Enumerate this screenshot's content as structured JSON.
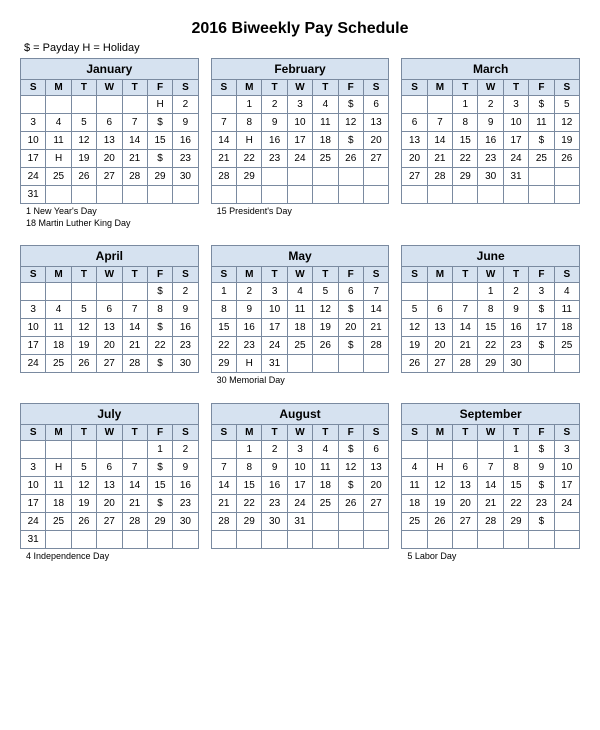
{
  "title": "2016 Biweekly Pay Schedule",
  "legend": "$ = Payday      H = Holiday",
  "dow": [
    "S",
    "M",
    "T",
    "W",
    "T",
    "F",
    "S"
  ],
  "months": [
    {
      "name": "January",
      "weeks": [
        [
          "",
          "",
          "",
          "",
          "",
          "H",
          "2"
        ],
        [
          "3",
          "4",
          "5",
          "6",
          "7",
          "$",
          "9"
        ],
        [
          "10",
          "11",
          "12",
          "13",
          "14",
          "15",
          "16"
        ],
        [
          "17",
          "H",
          "19",
          "20",
          "21",
          "$",
          "23"
        ],
        [
          "24",
          "25",
          "26",
          "27",
          "28",
          "29",
          "30"
        ],
        [
          "31",
          "",
          "",
          "",
          "",
          "",
          ""
        ]
      ],
      "notes": [
        "1 New Year's Day",
        "18 Martin Luther King Day"
      ]
    },
    {
      "name": "February",
      "weeks": [
        [
          "",
          "1",
          "2",
          "3",
          "4",
          "$",
          "6"
        ],
        [
          "7",
          "8",
          "9",
          "10",
          "11",
          "12",
          "13"
        ],
        [
          "14",
          "H",
          "16",
          "17",
          "18",
          "$",
          "20"
        ],
        [
          "21",
          "22",
          "23",
          "24",
          "25",
          "26",
          "27"
        ],
        [
          "28",
          "29",
          "",
          "",
          "",
          "",
          ""
        ]
      ],
      "notes": [
        "15 President's Day"
      ]
    },
    {
      "name": "March",
      "weeks": [
        [
          "",
          "",
          "1",
          "2",
          "3",
          "$",
          "5"
        ],
        [
          "6",
          "7",
          "8",
          "9",
          "10",
          "11",
          "12"
        ],
        [
          "13",
          "14",
          "15",
          "16",
          "17",
          "$",
          "19"
        ],
        [
          "20",
          "21",
          "22",
          "23",
          "24",
          "25",
          "26"
        ],
        [
          "27",
          "28",
          "29",
          "30",
          "31",
          "",
          ""
        ]
      ],
      "notes": []
    },
    {
      "name": "April",
      "weeks": [
        [
          "",
          "",
          "",
          "",
          "",
          "$",
          "2"
        ],
        [
          "3",
          "4",
          "5",
          "6",
          "7",
          "8",
          "9"
        ],
        [
          "10",
          "11",
          "12",
          "13",
          "14",
          "$",
          "16"
        ],
        [
          "17",
          "18",
          "19",
          "20",
          "21",
          "22",
          "23"
        ],
        [
          "24",
          "25",
          "26",
          "27",
          "28",
          "$",
          "30"
        ]
      ],
      "notes": []
    },
    {
      "name": "May",
      "weeks": [
        [
          "1",
          "2",
          "3",
          "4",
          "5",
          "6",
          "7"
        ],
        [
          "8",
          "9",
          "10",
          "11",
          "12",
          "$",
          "14"
        ],
        [
          "15",
          "16",
          "17",
          "18",
          "19",
          "20",
          "21"
        ],
        [
          "22",
          "23",
          "24",
          "25",
          "26",
          "$",
          "28"
        ],
        [
          "29",
          "H",
          "31",
          "",
          "",
          "",
          ""
        ]
      ],
      "notes": [
        "30 Memorial Day"
      ]
    },
    {
      "name": "June",
      "weeks": [
        [
          "",
          "",
          "",
          "1",
          "2",
          "3",
          "4"
        ],
        [
          "5",
          "6",
          "7",
          "8",
          "9",
          "$",
          "11"
        ],
        [
          "12",
          "13",
          "14",
          "15",
          "16",
          "17",
          "18"
        ],
        [
          "19",
          "20",
          "21",
          "22",
          "23",
          "$",
          "25"
        ],
        [
          "26",
          "27",
          "28",
          "29",
          "30",
          "",
          ""
        ]
      ],
      "notes": []
    },
    {
      "name": "July",
      "weeks": [
        [
          "",
          "",
          "",
          "",
          "",
          "1",
          "2"
        ],
        [
          "3",
          "H",
          "5",
          "6",
          "7",
          "$",
          "9"
        ],
        [
          "10",
          "11",
          "12",
          "13",
          "14",
          "15",
          "16"
        ],
        [
          "17",
          "18",
          "19",
          "20",
          "21",
          "$",
          "23"
        ],
        [
          "24",
          "25",
          "26",
          "27",
          "28",
          "29",
          "30"
        ],
        [
          "31",
          "",
          "",
          "",
          "",
          "",
          ""
        ]
      ],
      "notes": [
        "4 Independence Day"
      ]
    },
    {
      "name": "August",
      "weeks": [
        [
          "",
          "1",
          "2",
          "3",
          "4",
          "$",
          "6"
        ],
        [
          "7",
          "8",
          "9",
          "10",
          "11",
          "12",
          "13"
        ],
        [
          "14",
          "15",
          "16",
          "17",
          "18",
          "$",
          "20"
        ],
        [
          "21",
          "22",
          "23",
          "24",
          "25",
          "26",
          "27"
        ],
        [
          "28",
          "29",
          "30",
          "31",
          "",
          "",
          ""
        ]
      ],
      "notes": []
    },
    {
      "name": "September",
      "weeks": [
        [
          "",
          "",
          "",
          "",
          "1",
          "$",
          "3"
        ],
        [
          "4",
          "H",
          "6",
          "7",
          "8",
          "9",
          "10"
        ],
        [
          "11",
          "12",
          "13",
          "14",
          "15",
          "$",
          "17"
        ],
        [
          "18",
          "19",
          "20",
          "21",
          "22",
          "23",
          "24"
        ],
        [
          "25",
          "26",
          "27",
          "28",
          "29",
          "$",
          ""
        ]
      ],
      "notes": [
        "5 Labor Day"
      ]
    }
  ]
}
